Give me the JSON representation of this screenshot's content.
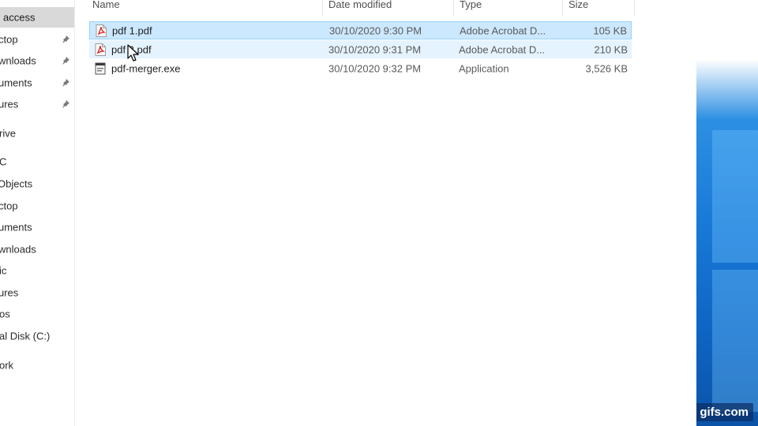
{
  "nav": {
    "items": [
      {
        "label": "access",
        "pinned": false,
        "selected": true
      },
      {
        "label": "ctop",
        "pinned": true,
        "selected": false
      },
      {
        "label": "wnloads",
        "pinned": true,
        "selected": false
      },
      {
        "label": "uments",
        "pinned": true,
        "selected": false
      },
      {
        "label": "ures",
        "pinned": true,
        "selected": false
      },
      {
        "label": "rive",
        "pinned": false,
        "selected": false
      },
      {
        "label": "C",
        "pinned": false,
        "selected": false
      },
      {
        "label": "Objects",
        "pinned": false,
        "selected": false
      },
      {
        "label": "ctop",
        "pinned": false,
        "selected": false
      },
      {
        "label": "uments",
        "pinned": false,
        "selected": false
      },
      {
        "label": "wnloads",
        "pinned": false,
        "selected": false
      },
      {
        "label": "ic",
        "pinned": false,
        "selected": false
      },
      {
        "label": "ures",
        "pinned": false,
        "selected": false
      },
      {
        "label": "os",
        "pinned": false,
        "selected": false
      },
      {
        "label": "al Disk (C:)",
        "pinned": false,
        "selected": false
      },
      {
        "label": "ork",
        "pinned": false,
        "selected": false
      }
    ]
  },
  "columns": {
    "name": "Name",
    "date": "Date modified",
    "type": "Type",
    "size": "Size"
  },
  "files": [
    {
      "name": "pdf 1.pdf",
      "date": "30/10/2020 9:30 PM",
      "type": "Adobe Acrobat D...",
      "size": "105 KB",
      "icon": "pdf-icon",
      "state": "selected"
    },
    {
      "name": "pdf 2.pdf",
      "date": "30/10/2020 9:31 PM",
      "type": "Adobe Acrobat D...",
      "size": "210 KB",
      "icon": "pdf-icon",
      "state": "hover"
    },
    {
      "name": "pdf-merger.exe",
      "date": "30/10/2020 9:32 PM",
      "type": "Application",
      "size": "3,526 KB",
      "icon": "exe-icon",
      "state": "normal"
    }
  ],
  "watermark": "gifs.com",
  "colors": {
    "selection": "#cce8ff",
    "hover": "#e5f3ff",
    "nav_selected": "#d9d9d9",
    "desktop_blue": "#1877d6"
  }
}
